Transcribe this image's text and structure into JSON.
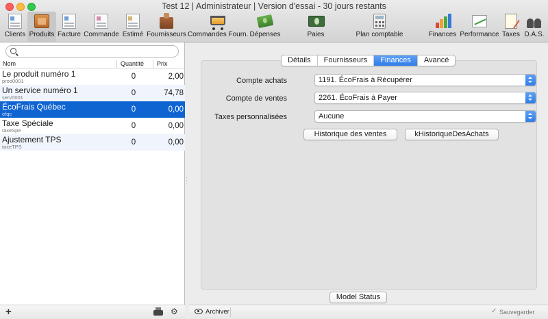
{
  "window": {
    "title": "Test 12 | Administrateur | Version d'essai  - 30 jours restants"
  },
  "toolbar": {
    "items": [
      {
        "label": "Clients",
        "icon": "clients-icon"
      },
      {
        "label": "Produits",
        "icon": "products-icon",
        "selected": true
      },
      {
        "label": "Facture",
        "icon": "invoice-icon"
      },
      {
        "label": "Commande",
        "icon": "order-icon"
      },
      {
        "label": "Estimé",
        "icon": "estimate-icon"
      },
      {
        "label": "Fournisseurs",
        "icon": "suppliers-icon"
      },
      {
        "label": "Commandes Fourn.",
        "icon": "cart-icon"
      },
      {
        "label": "Dépenses",
        "icon": "expenses-icon"
      },
      {
        "label": "Paies",
        "icon": "payroll-icon"
      },
      {
        "label": "Plan comptable",
        "icon": "calculator-icon"
      },
      {
        "label": "Finances",
        "icon": "bar-chart-icon"
      },
      {
        "label": "Performance",
        "icon": "trend-icon"
      },
      {
        "label": "Taxes",
        "icon": "tax-icon"
      },
      {
        "label": "D.A.S.",
        "icon": "people-icon"
      }
    ]
  },
  "list": {
    "search_placeholder": "",
    "columns": {
      "name": "Nom",
      "quantity": "Quantité",
      "price": "Prix"
    },
    "rows": [
      {
        "name": "Le produit numéro 1",
        "code": "prod0001",
        "quantity": "0",
        "price": "2,00"
      },
      {
        "name": "Un service numéro 1",
        "code": "serv0001",
        "quantity": "0",
        "price": "74,78"
      },
      {
        "name": "ÉcoFrais Québec",
        "code": "efqc",
        "quantity": "0",
        "price": "0,00",
        "selected": true
      },
      {
        "name": "Taxe Spéciale",
        "code": "taxeSpe",
        "quantity": "0",
        "price": "0,00"
      },
      {
        "name": "Ajustement TPS",
        "code": "taxeTPS",
        "quantity": "0",
        "price": "0,00"
      }
    ],
    "footer": {
      "add": "+",
      "settings": "⚙"
    }
  },
  "detail": {
    "tabs": [
      {
        "label": "Détails"
      },
      {
        "label": "Fournisseurs"
      },
      {
        "label": "Finances",
        "active": true
      },
      {
        "label": "Avancé"
      }
    ],
    "fields": {
      "purchase_account": {
        "label": "Compte achats",
        "value": "1191. ÉcoFrais à Récupérer"
      },
      "sales_account": {
        "label": "Compte de ventes",
        "value": "2261. ÉcoFrais à Payer"
      },
      "custom_taxes": {
        "label": "Taxes personnalisées",
        "value": "Aucune"
      }
    },
    "buttons": {
      "sales_history": "Historique des ventes",
      "purchase_history": "kHistoriqueDesAchats",
      "model_status": "Model Status"
    },
    "footer": {
      "archive": "Archiver",
      "save": "Sauvegarder",
      "check": "✓"
    }
  },
  "colors": {
    "selection": "#0f64d2",
    "accent": "#2f7de6"
  }
}
